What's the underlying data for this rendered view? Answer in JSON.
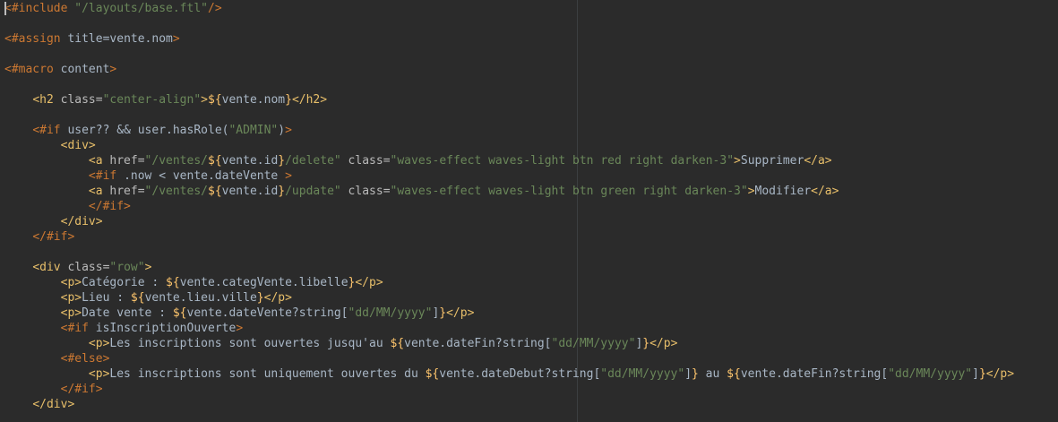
{
  "editor": {
    "language": "FreeMarker (FTL)",
    "colors": {
      "background": "#2b2b2b",
      "ftl_directive": "#cc7832",
      "html_tag": "#e8bf6a",
      "attribute": "#bababa",
      "string": "#6a8759",
      "text": "#a9b7c6",
      "interpolation": "#ffc66d"
    },
    "lines": [
      [
        {
          "t": "<#include ",
          "c": "ftl"
        },
        {
          "t": "\"/layouts/base.ftl\"",
          "c": "str"
        },
        {
          "t": "/>",
          "c": "ftl"
        }
      ],
      [],
      [
        {
          "t": "<#assign ",
          "c": "ftl"
        },
        {
          "t": "title=vente.nom",
          "c": "text"
        },
        {
          "t": ">",
          "c": "ftl"
        }
      ],
      [],
      [
        {
          "t": "<#macro ",
          "c": "ftl"
        },
        {
          "t": "content",
          "c": "text"
        },
        {
          "t": ">",
          "c": "ftl"
        }
      ],
      [],
      [
        {
          "t": "    ",
          "c": "text"
        },
        {
          "t": "<h2 ",
          "c": "tag"
        },
        {
          "t": "class=",
          "c": "attr"
        },
        {
          "t": "\"center-align\"",
          "c": "str"
        },
        {
          "t": ">",
          "c": "tag"
        },
        {
          "t": "${",
          "c": "dollar"
        },
        {
          "t": "vente.nom",
          "c": "expr"
        },
        {
          "t": "}",
          "c": "dollar"
        },
        {
          "t": "</h2>",
          "c": "tag"
        }
      ],
      [],
      [
        {
          "t": "    ",
          "c": "text"
        },
        {
          "t": "<#if ",
          "c": "ftl"
        },
        {
          "t": "user?? && user.hasRole(",
          "c": "text"
        },
        {
          "t": "\"ADMIN\"",
          "c": "str"
        },
        {
          "t": ")",
          "c": "text"
        },
        {
          "t": ">",
          "c": "ftl"
        }
      ],
      [
        {
          "t": "        ",
          "c": "text"
        },
        {
          "t": "<div>",
          "c": "tag"
        }
      ],
      [
        {
          "t": "            ",
          "c": "text"
        },
        {
          "t": "<a ",
          "c": "tag"
        },
        {
          "t": "href=",
          "c": "attr"
        },
        {
          "t": "\"/ventes/",
          "c": "str"
        },
        {
          "t": "${",
          "c": "dollar"
        },
        {
          "t": "vente.id",
          "c": "expr"
        },
        {
          "t": "}",
          "c": "dollar"
        },
        {
          "t": "/delete\"",
          "c": "str"
        },
        {
          "t": " class=",
          "c": "attr"
        },
        {
          "t": "\"waves-effect waves-light btn red right darken-3\"",
          "c": "str"
        },
        {
          "t": ">",
          "c": "tag"
        },
        {
          "t": "Supprimer",
          "c": "text"
        },
        {
          "t": "</a>",
          "c": "tag"
        }
      ],
      [
        {
          "t": "            ",
          "c": "text"
        },
        {
          "t": "<#if ",
          "c": "ftl"
        },
        {
          "t": ".now < vente.dateVente ",
          "c": "text"
        },
        {
          "t": ">",
          "c": "ftl"
        }
      ],
      [
        {
          "t": "            ",
          "c": "text"
        },
        {
          "t": "<a ",
          "c": "tag"
        },
        {
          "t": "href=",
          "c": "attr"
        },
        {
          "t": "\"/ventes/",
          "c": "str"
        },
        {
          "t": "${",
          "c": "dollar"
        },
        {
          "t": "vente.id",
          "c": "expr"
        },
        {
          "t": "}",
          "c": "dollar"
        },
        {
          "t": "/update\"",
          "c": "str"
        },
        {
          "t": " class=",
          "c": "attr"
        },
        {
          "t": "\"waves-effect waves-light btn green right darken-3\"",
          "c": "str"
        },
        {
          "t": ">",
          "c": "tag"
        },
        {
          "t": "Modifier",
          "c": "text"
        },
        {
          "t": "</a>",
          "c": "tag"
        }
      ],
      [
        {
          "t": "            ",
          "c": "text"
        },
        {
          "t": "</#if>",
          "c": "ftl"
        }
      ],
      [
        {
          "t": "        ",
          "c": "text"
        },
        {
          "t": "</div>",
          "c": "tag"
        }
      ],
      [
        {
          "t": "    ",
          "c": "text"
        },
        {
          "t": "</#if>",
          "c": "ftl"
        }
      ],
      [],
      [
        {
          "t": "    ",
          "c": "text"
        },
        {
          "t": "<div ",
          "c": "tag"
        },
        {
          "t": "class=",
          "c": "attr"
        },
        {
          "t": "\"row\"",
          "c": "str"
        },
        {
          "t": ">",
          "c": "tag"
        }
      ],
      [
        {
          "t": "        ",
          "c": "text"
        },
        {
          "t": "<p>",
          "c": "tag"
        },
        {
          "t": "Catégorie : ",
          "c": "text"
        },
        {
          "t": "${",
          "c": "dollar"
        },
        {
          "t": "vente.categVente.libelle",
          "c": "expr"
        },
        {
          "t": "}",
          "c": "dollar"
        },
        {
          "t": "</p>",
          "c": "tag"
        }
      ],
      [
        {
          "t": "        ",
          "c": "text"
        },
        {
          "t": "<p>",
          "c": "tag"
        },
        {
          "t": "Lieu : ",
          "c": "text"
        },
        {
          "t": "${",
          "c": "dollar"
        },
        {
          "t": "vente.lieu.ville",
          "c": "expr"
        },
        {
          "t": "}",
          "c": "dollar"
        },
        {
          "t": "</p>",
          "c": "tag"
        }
      ],
      [
        {
          "t": "        ",
          "c": "text"
        },
        {
          "t": "<p>",
          "c": "tag"
        },
        {
          "t": "Date vente : ",
          "c": "text"
        },
        {
          "t": "${",
          "c": "dollar"
        },
        {
          "t": "vente.dateVente?string[",
          "c": "expr"
        },
        {
          "t": "\"dd/MM/yyyy\"",
          "c": "str"
        },
        {
          "t": "]",
          "c": "expr"
        },
        {
          "t": "}",
          "c": "dollar"
        },
        {
          "t": "</p>",
          "c": "tag"
        }
      ],
      [
        {
          "t": "        ",
          "c": "text"
        },
        {
          "t": "<#if ",
          "c": "ftl"
        },
        {
          "t": "isInscriptionOuverte",
          "c": "text"
        },
        {
          "t": ">",
          "c": "ftl"
        }
      ],
      [
        {
          "t": "            ",
          "c": "text"
        },
        {
          "t": "<p>",
          "c": "tag"
        },
        {
          "t": "Les inscriptions sont ouvertes jusqu'au ",
          "c": "text"
        },
        {
          "t": "${",
          "c": "dollar"
        },
        {
          "t": "vente.dateFin?string[",
          "c": "expr"
        },
        {
          "t": "\"dd/MM/yyyy\"",
          "c": "str"
        },
        {
          "t": "]",
          "c": "expr"
        },
        {
          "t": "}",
          "c": "dollar"
        },
        {
          "t": "</p>",
          "c": "tag"
        }
      ],
      [
        {
          "t": "        ",
          "c": "text"
        },
        {
          "t": "<#else>",
          "c": "ftl"
        }
      ],
      [
        {
          "t": "            ",
          "c": "text"
        },
        {
          "t": "<p>",
          "c": "tag"
        },
        {
          "t": "Les inscriptions sont uniquement ouvertes du ",
          "c": "text"
        },
        {
          "t": "${",
          "c": "dollar"
        },
        {
          "t": "vente.dateDebut?string[",
          "c": "expr"
        },
        {
          "t": "\"dd/MM/yyyy\"",
          "c": "str"
        },
        {
          "t": "]",
          "c": "expr"
        },
        {
          "t": "}",
          "c": "dollar"
        },
        {
          "t": " au ",
          "c": "text"
        },
        {
          "t": "${",
          "c": "dollar"
        },
        {
          "t": "vente.dateFin?string[",
          "c": "expr"
        },
        {
          "t": "\"dd/MM/yyyy\"",
          "c": "str"
        },
        {
          "t": "]",
          "c": "expr"
        },
        {
          "t": "}",
          "c": "dollar"
        },
        {
          "t": "</p>",
          "c": "tag"
        }
      ],
      [
        {
          "t": "        ",
          "c": "text"
        },
        {
          "t": "</#if>",
          "c": "ftl"
        }
      ],
      [
        {
          "t": "    ",
          "c": "text"
        },
        {
          "t": "</div>",
          "c": "tag"
        }
      ]
    ]
  }
}
